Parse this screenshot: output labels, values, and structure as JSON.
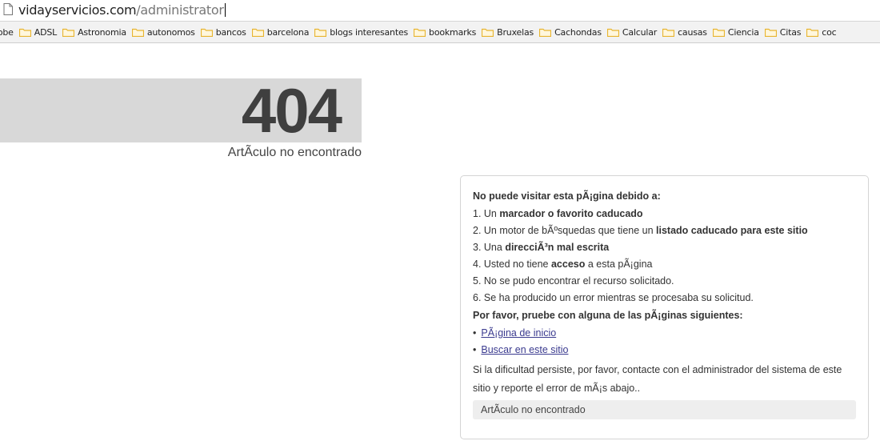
{
  "browser": {
    "url_host": "vidayservicios.com",
    "url_path": "/administrator"
  },
  "bookmarks": [
    "lobe",
    "ADSL",
    "Astronomia",
    "autonomos",
    "bancos",
    "barcelona",
    "blogs interesantes",
    "bookmarks",
    "Bruxelas",
    "Cachondas",
    "Calcular",
    "causas",
    "Ciencia",
    "Citas",
    "coc"
  ],
  "error": {
    "code": "404",
    "subtitle": "ArtÃculo no encontrado"
  },
  "card": {
    "heading": "No puede visitar esta pÃ¡gina debido a:",
    "reasons": [
      {
        "pre": "1. Un ",
        "bold": "marcador o favorito caducado",
        "post": ""
      },
      {
        "pre": "2. Un motor de bÃºsquedas que tiene un ",
        "bold": "listado caducado para este sitio",
        "post": ""
      },
      {
        "pre": "3. Una ",
        "bold": "direcciÃ³n mal escrita",
        "post": ""
      },
      {
        "pre": "4. Usted no tiene ",
        "bold": "acceso",
        "post": " a esta pÃ¡gina"
      },
      {
        "pre": "5. No se pudo encontrar el recurso solicitado.",
        "bold": "",
        "post": ""
      },
      {
        "pre": "6. Se ha producido un error mientras se procesaba su solicitud.",
        "bold": "",
        "post": ""
      }
    ],
    "try_heading": "Por favor, pruebe con alguna de las pÃ¡ginas siguientes:",
    "links": [
      "PÃ¡gina de inicio",
      "Buscar en este sitio"
    ],
    "note": "Si la dificultad persiste, por favor, contacte con el administrador del sistema de este sitio y reporte el error de mÃ¡s abajo..",
    "footer": "ArtÃculo no encontrado"
  },
  "colors": {
    "folder": "#e8b530",
    "link": "#3b3b8f",
    "band": "#d8d8d8"
  }
}
